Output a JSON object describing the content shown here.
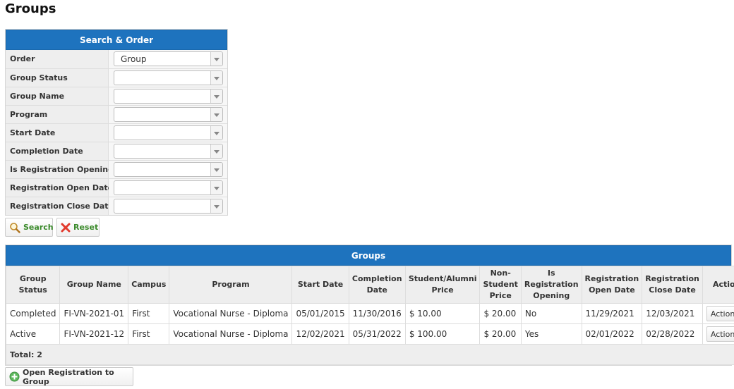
{
  "page": {
    "title": "Groups"
  },
  "search": {
    "title": "Search & Order",
    "fields": [
      {
        "label": "Order",
        "value": "Group"
      },
      {
        "label": "Group Status",
        "value": ""
      },
      {
        "label": "Group Name",
        "value": ""
      },
      {
        "label": "Program",
        "value": ""
      },
      {
        "label": "Start Date",
        "value": ""
      },
      {
        "label": "Completion Date",
        "value": ""
      },
      {
        "label": "Is Registration Opening",
        "value": ""
      },
      {
        "label": "Registration Open Date",
        "value": ""
      },
      {
        "label": "Registration Close Date",
        "value": ""
      }
    ],
    "search_label": "Search",
    "reset_label": "Reset"
  },
  "groups": {
    "title": "Groups",
    "columns": [
      "Group Status",
      "Group Name",
      "Campus",
      "Program",
      "Start Date",
      "Completion Date",
      "Student/Alumni Price",
      "Non-Student Price",
      "Is Registration Opening",
      "Registration Open Date",
      "Registration Close Date",
      "Actions"
    ],
    "rows": [
      [
        "Completed",
        "FI-VN-2021-01",
        "First",
        "Vocational Nurse - Diploma",
        "05/01/2015",
        "11/30/2016",
        "$ 10.00",
        "$ 20.00",
        "No",
        "11/29/2021",
        "12/03/2021"
      ],
      [
        "Active",
        "FI-VN-2021-12",
        "First",
        "Vocational Nurse - Diploma",
        "12/02/2021",
        "05/31/2022",
        "$ 100.00",
        "$ 20.00",
        "Yes",
        "02/01/2022",
        "02/28/2022"
      ]
    ],
    "actions_label": "Actions",
    "total_label": "Total: 2"
  },
  "open_registration_label": "Open Registration to Group",
  "colors": {
    "header_blue": "#1e73be",
    "label_green": "#3a8a2a"
  }
}
